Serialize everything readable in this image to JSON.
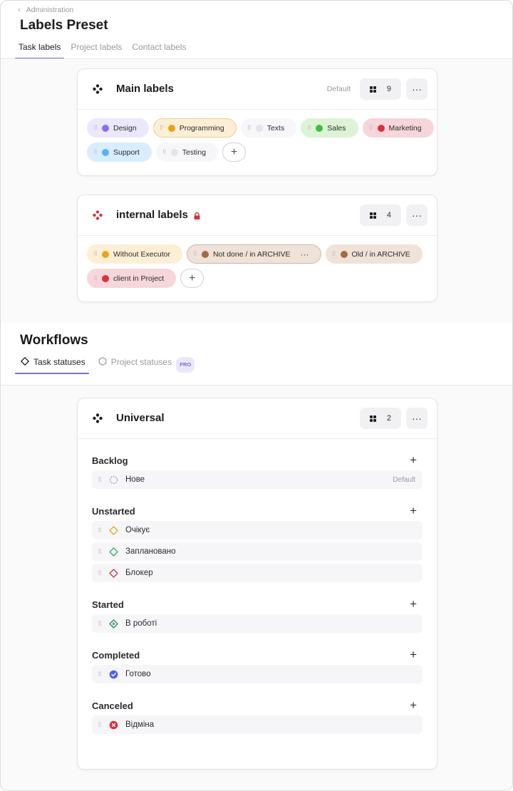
{
  "breadcrumb": {
    "label": "Administration"
  },
  "page_title": "Labels Preset",
  "tabs": [
    {
      "label": "Task labels",
      "active": true
    },
    {
      "label": "Project labels",
      "active": false
    },
    {
      "label": "Contact labels",
      "active": false
    }
  ],
  "main_card": {
    "title": "Main labels",
    "default_tag": "Default",
    "count": "9",
    "icon": "diamond-dots-icon",
    "labels": [
      {
        "text": "Design",
        "dot": "#8b6fe6",
        "bg": "#ece8fb",
        "border": "#ece8fb"
      },
      {
        "text": "Programming",
        "dot": "#e9a21a",
        "bg": "#fcefd6",
        "border": "#eccf91"
      },
      {
        "text": "Texts",
        "dot": "#e4e4e8",
        "bg": "#f7f7f9",
        "border": "#f7f7f9"
      },
      {
        "text": "Sales",
        "dot": "#3fbf3f",
        "bg": "#dcf3d6",
        "border": "#dcf3d6"
      },
      {
        "text": "Marketing",
        "dot": "#d8323d",
        "bg": "#f6d6da",
        "border": "#f6d6da"
      },
      {
        "text": "Support",
        "dot": "#56b4f3",
        "bg": "#d8edfd",
        "border": "#d8edfd"
      },
      {
        "text": "Testing",
        "dot": "#e4e4e8",
        "bg": "#f7f7f9",
        "border": "#f7f7f9"
      }
    ],
    "add_label": "+"
  },
  "internal_card": {
    "title": "internal labels",
    "count": "4",
    "icon": "diamond-dots-red-icon",
    "labels": [
      {
        "text": "Without Executor",
        "dot": "#e9a21a",
        "bg": "#fcefd6",
        "border": "#fcefd6"
      },
      {
        "text": "Not done / in ARCHIVE",
        "dot": "#a46a45",
        "bg": "#efe2d8",
        "border": "#cbb7a8",
        "more": "···"
      },
      {
        "text": "Old / in ARCHIVE",
        "dot": "#a46a45",
        "bg": "#efe2d8",
        "border": "#efe2d8"
      },
      {
        "text": "client in Project",
        "dot": "#d8323d",
        "bg": "#f6d6da",
        "border": "#f6d6da"
      }
    ],
    "add_label": "+"
  },
  "workflows": {
    "title": "Workflows",
    "tabs": [
      {
        "label": "Task statuses",
        "active": true,
        "icon": "diamond-outline-icon"
      },
      {
        "label": "Project statuses",
        "active": false,
        "icon": "hexagon-outline-icon",
        "badge": "PRO"
      }
    ]
  },
  "universal_card": {
    "title": "Universal",
    "count": "2",
    "icon": "diamond-dots-icon",
    "groups": [
      {
        "name": "Backlog",
        "statuses": [
          {
            "label": "Нове",
            "icon": "dashed-circle-icon",
            "default": "Default"
          }
        ]
      },
      {
        "name": "Unstarted",
        "statuses": [
          {
            "label": "Очікує",
            "icon": "diamond-yellow-icon"
          },
          {
            "label": "Заплановано",
            "icon": "diamond-green-icon"
          },
          {
            "label": "Блокер",
            "icon": "diamond-red-icon"
          }
        ]
      },
      {
        "name": "Started",
        "statuses": [
          {
            "label": "В роботі",
            "icon": "diamond-play-icon"
          }
        ]
      },
      {
        "name": "Completed",
        "statuses": [
          {
            "label": "Готово",
            "icon": "check-badge-icon"
          }
        ]
      },
      {
        "name": "Canceled",
        "statuses": [
          {
            "label": "Відміна",
            "icon": "cancel-circle-icon"
          }
        ]
      }
    ]
  },
  "colors": {
    "accent": "#7d6be0",
    "lock": "#d8323d"
  }
}
